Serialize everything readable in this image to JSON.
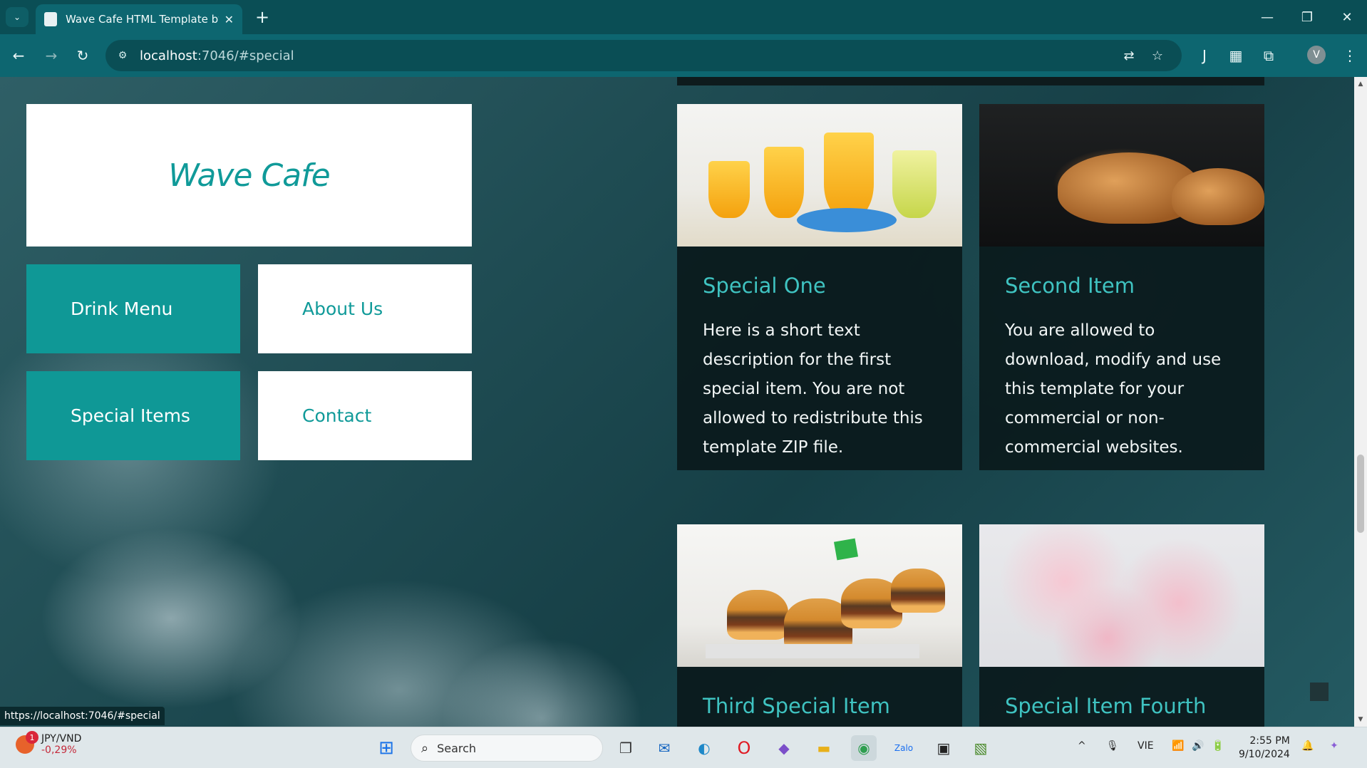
{
  "browser": {
    "tab_title": "Wave Cafe HTML Template by T",
    "url_host": "localhost",
    "url_path": ":7046/#special",
    "status_url": "https://localhost:7046/#special",
    "profile_initial": "V"
  },
  "page": {
    "logo": "Wave Cafe",
    "nav": [
      {
        "label": "Drink Menu",
        "active": true
      },
      {
        "label": "About Us",
        "active": false
      },
      {
        "label": "Special Items",
        "active": true
      },
      {
        "label": "Contact",
        "active": false
      }
    ],
    "cards": [
      {
        "title": "Special One",
        "text": "Here is a short text description for the first special item. You are not allowed to redistribute this template ZIP file.",
        "image": "orange-juice-glasses"
      },
      {
        "title": "Second Item",
        "text": "You are allowed to download, modify and use this template for your commercial or non-commercial websites.",
        "image": "croissants"
      },
      {
        "title": "Third Special Item",
        "text": "",
        "image": "mini-burgers"
      },
      {
        "title": "Special Item Fourth",
        "text": "",
        "image": "pink-meringues"
      }
    ],
    "colors": {
      "teal": "#109a99",
      "card_bg": "#0a181b",
      "card_title": "#3fc3c1"
    }
  },
  "taskbar": {
    "ticker_pair": "JPY/VND",
    "ticker_change": "-0,29%",
    "ticker_badge": "1",
    "search_label": "Search",
    "language": "VIE",
    "time": "2:55 PM",
    "date": "9/10/2024"
  }
}
